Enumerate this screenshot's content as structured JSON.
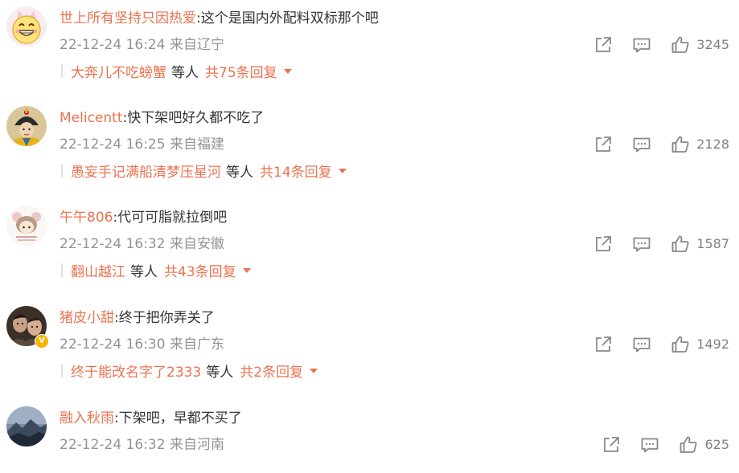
{
  "comments": [
    {
      "username": "世上所有坚持只因热爱",
      "text": ":这个是国内外配料双标那个吧",
      "time": "22-12-24 16:24",
      "location": "来自辽宁",
      "likes": "3245",
      "reply_user": "大奔儿不吃螃蟹",
      "reply_etc": "等人",
      "reply_total": "共75条回复",
      "avatar_icon": "grinning-face-icon"
    },
    {
      "username": "Melicentt",
      "text": ":快下架吧好久都不吃了",
      "time": "22-12-24 16:25",
      "location": "来自福建",
      "likes": "2128",
      "reply_user": "愚妄手记满船清梦压星河",
      "reply_etc": "等人",
      "reply_total": "共14条回复",
      "avatar_icon": "emperor-portrait-icon"
    },
    {
      "username": "午午806",
      "text": ":代可可脂就拉倒吧",
      "time": "22-12-24 16:32",
      "location": "来自安徽",
      "likes": "1587",
      "reply_user": "翻山越江",
      "reply_etc": "等人",
      "reply_total": "共43条回复",
      "avatar_icon": "cartoon-girl-icon"
    },
    {
      "username": "猪皮小甜",
      "text": ":终于把你弄关了",
      "time": "22-12-24 16:30",
      "location": "来自广东",
      "likes": "1492",
      "reply_user": "终于能改名字了2333",
      "reply_etc": "等人",
      "reply_total": "共2条回复",
      "avatar_icon": "group-photo-icon",
      "verified_badge": "V"
    },
    {
      "username": "融入秋雨",
      "text": ":下架吧，早都不买了",
      "time": "22-12-24 16:32",
      "location": "来自河南",
      "likes": "625",
      "avatar_icon": "mountain-landscape-icon"
    }
  ],
  "colors": {
    "username": "#eb7350",
    "text": "#333333",
    "meta": "#939393",
    "icon": "#888888"
  }
}
